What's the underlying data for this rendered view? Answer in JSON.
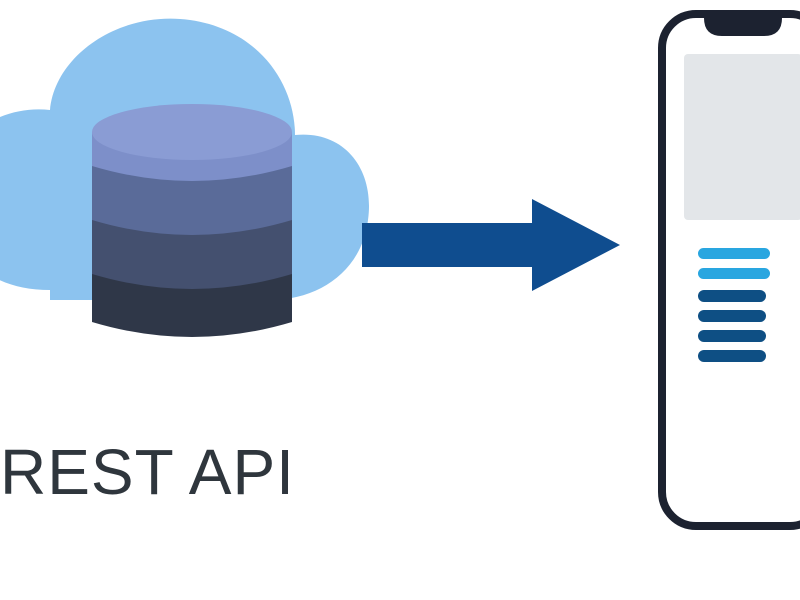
{
  "label": "REST API",
  "colors": {
    "cloud": "#8cc3ef",
    "db_top": "#7d8fc9",
    "db_mid": "#5a6b99",
    "db_low": "#44506f",
    "db_base": "#2f3748",
    "arrow": "#0f4d8f",
    "phone_outline": "#1c2230",
    "phone_screen_block": "#e3e6e9",
    "phone_bar_dark": "#0e4f84",
    "phone_bar_light": "#29a6e0",
    "text": "#2f363d"
  }
}
